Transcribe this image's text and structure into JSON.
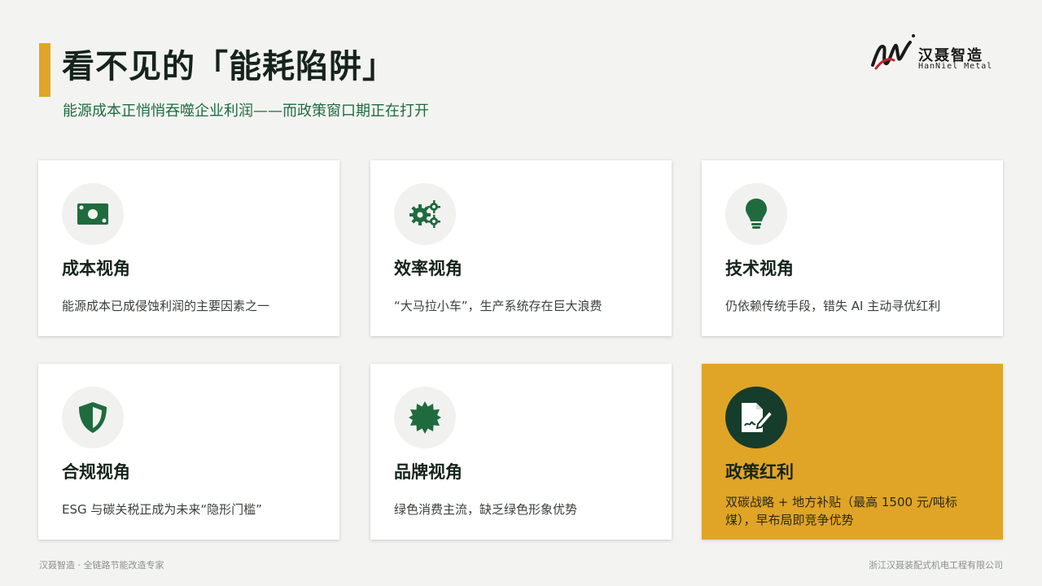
{
  "header": {
    "title": "看不见的「能耗陷阱」",
    "subtitle": "能源成本正悄悄吞噬企业利润——而政策窗口期正在打开"
  },
  "logo": {
    "name_cn": "汉聂智造",
    "name_en": "HanNiel Metal"
  },
  "cards": [
    {
      "title": "成本视角",
      "desc": "能源成本已成侵蚀利润的主要因素之一",
      "icon": "money-bill-icon"
    },
    {
      "title": "效率视角",
      "desc": "“大马拉小车”，生产系统存在巨大浪费",
      "icon": "gears-icon"
    },
    {
      "title": "技术视角",
      "desc": "仍依赖传统手段，错失 AI 主动寻优红利",
      "icon": "lightbulb-icon"
    },
    {
      "title": "合规视角",
      "desc": "ESG 与碳关税正成为未来“隐形门槛”",
      "icon": "shield-icon"
    },
    {
      "title": "品牌视角",
      "desc": "绿色消费主流，缺乏绿色形象优势",
      "icon": "certificate-icon"
    },
    {
      "title": "政策红利",
      "desc": "双碳战略 + 地方补贴（最高 1500 元/吨标煤），早布局即竞争优势",
      "icon": "signed-document-icon"
    }
  ],
  "footer": {
    "left": "汉聂智造 · 全链路节能改造专家",
    "right": "浙江汉聂装配式机电工程有限公司"
  },
  "colors": {
    "accent": "#e0a526",
    "green": "#1f6b3e",
    "dark_green": "#163c2b"
  }
}
